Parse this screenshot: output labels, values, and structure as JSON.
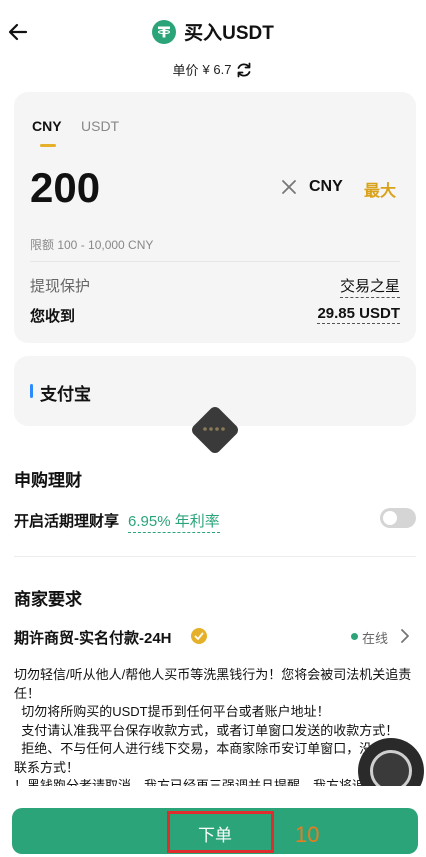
{
  "header": {
    "back_icon": "arrow-left-icon",
    "logo_icon": "tether-logo",
    "title": "买入USDT",
    "price_label": "单价",
    "price_value": "¥ 6.7",
    "refresh_icon": "refresh-icon"
  },
  "order_card": {
    "tabs": [
      {
        "label": "CNY",
        "active": true
      },
      {
        "label": "USDT",
        "active": false
      }
    ],
    "amount": "200",
    "clear_icon": "close-icon",
    "currency": "CNY",
    "max_label": "最大",
    "limit_text": "限额 100 - 10,000 CNY",
    "protection_label": "提现保护",
    "protection_value": "交易之星",
    "receive_label": "您收到",
    "receive_value": "29.85 USDT"
  },
  "payment": {
    "method": "支付宝",
    "accent": "#2e8bff"
  },
  "finance": {
    "title": "申购理财",
    "earn_label": "开启活期理财享",
    "earn_rate": "6.95% 年利率",
    "toggle_on": false
  },
  "merchant": {
    "title": "商家要求",
    "name": "期许商贸-实名付款-24H",
    "status": "在线",
    "terms": [
      "切勿轻信/听从他人/帮他人买币等洗黑钱行为！您将会被司法机关追责任！",
      "  切勿将所购买的USDT提币到任何平台或者账户地址！",
      "  支付请认准我平台保存收款方式，或者订单窗口发送的收款方式！",
      "  拒绝、不与任何人进行线下交易，本商家除币安订单窗口，没有其他联系方式！",
      "！黑钱跑分者请取消，我方已经再三强调并且提醒，我方将追究责任，并且将积极配合公安机关取证调查工作！"
    ]
  },
  "footer": {
    "order_button": "下单",
    "annotation_number": "10"
  },
  "colors": {
    "brand_green": "#2ba47a",
    "accent_gold": "#d9a21a",
    "annotation_red": "#e02c2c",
    "annotation_orange": "#e87c1e"
  }
}
